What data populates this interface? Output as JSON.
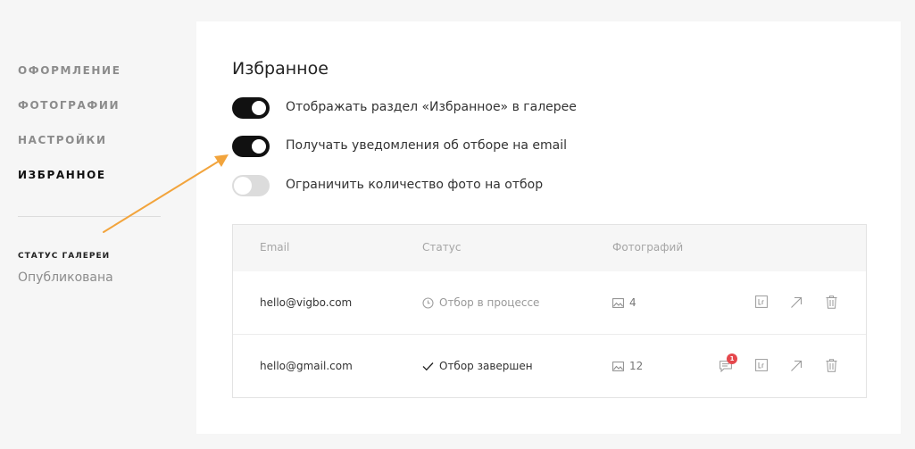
{
  "sidebar": {
    "items": [
      {
        "label": "ОФОРМЛЕНИЕ"
      },
      {
        "label": "ФОТОГРАФИИ"
      },
      {
        "label": "НАСТРОЙКИ"
      },
      {
        "label": "ИЗБРАННОЕ"
      }
    ],
    "active_item": "ИЗБРАННОЕ",
    "status_label": "СТАТУС ГАЛЕРЕИ",
    "status_value": "Опубликована"
  },
  "panel": {
    "title": "Избранное",
    "toggles": [
      {
        "label": "Отображать раздел «Избранное» в галерее",
        "on": true
      },
      {
        "label": "Получать уведомления об отборе на email",
        "on": true
      },
      {
        "label": "Ограничить количество фото на отбор",
        "on": false
      }
    ]
  },
  "table": {
    "headers": {
      "email": "Email",
      "status": "Статус",
      "photos": "Фотографий"
    },
    "rows": [
      {
        "email": "hello@vigbo.com",
        "status": "Отбор в процессе",
        "status_icon": "clock-icon",
        "photos": "4",
        "has_comments": false
      },
      {
        "email": "hello@gmail.com",
        "status": "Отбор завершен",
        "status_icon": "check-icon",
        "photos": "12",
        "has_comments": true,
        "comment_badge": "1"
      }
    ]
  },
  "colors": {
    "accent_arrow": "#f2a43c",
    "toggle_on": "#111111",
    "toggle_off": "#dcdcdc",
    "badge": "#e5484d"
  }
}
